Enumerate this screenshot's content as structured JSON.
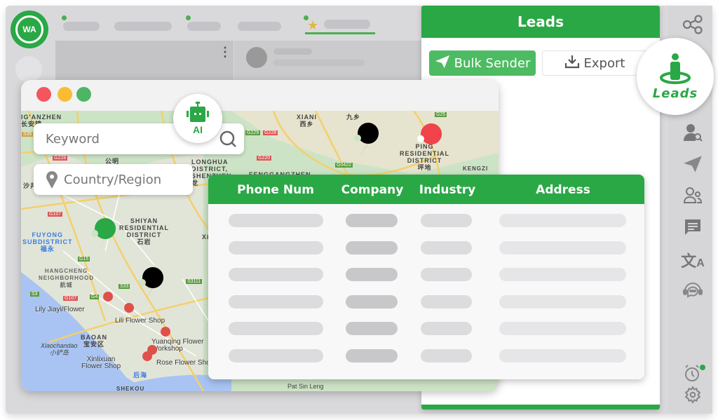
{
  "app": {
    "logo_text": "WA",
    "tabs": [
      {
        "active": false,
        "dot": true
      },
      {
        "active": false,
        "dot": false
      },
      {
        "active": false,
        "dot": true
      },
      {
        "active": false,
        "dot": false
      },
      {
        "active": true,
        "dot": true,
        "starred": true
      }
    ]
  },
  "leads_panel": {
    "title": "Leads",
    "bulk_sender_label": "Bulk Sender",
    "export_label": "Export"
  },
  "leads_badge": {
    "label": "Leads"
  },
  "right_sidebar": {
    "icons": [
      "share-icon",
      "contact-search-icon",
      "send-icon",
      "contacts-icon",
      "chat-icon",
      "translate-icon",
      "support-icon",
      "alarm-icon",
      "settings-icon"
    ]
  },
  "map_window": {
    "ai_label": "AI",
    "keyword_placeholder": "Keyword",
    "country_placeholder": "Country/Region",
    "labels": [
      "IG'ANZHEN",
      "长安镇",
      "XIANI",
      "西乡",
      "九乡",
      "PING",
      "RESIDENTIAL",
      "DISTRICT",
      "坪地",
      "LONGHUA",
      "DISTRICT,",
      "SHENZHEN",
      "龙",
      "FENGGANGZHEN",
      "公明",
      "SHIYAN",
      "RESIDENTIAL",
      "DISTRICT",
      "石岩",
      "FUYONG",
      "SUBDISTRICT",
      "福永",
      "HANGCHENG",
      "NEIGHBORHOOD",
      "航城",
      "BAOAN",
      "宝安区",
      "Xiaochandao",
      "小铲岛",
      "后海",
      "SHEKOU",
      "KENGZI",
      "Pat Sin Leng",
      "Xi",
      "沙井"
    ],
    "shops": [
      "Lily Jiayi/Flower",
      "Lili Flower Shop",
      "Yuanqing Flower",
      "Workshop",
      "Xinlixuan",
      "Flower Shop",
      "Rose Flower Shop"
    ],
    "roads": [
      "G107",
      "G15",
      "G4",
      "S33",
      "S3111",
      "S3",
      "G228",
      "G220",
      "G0422",
      "G25",
      "G229",
      "S35"
    ]
  },
  "table": {
    "columns": [
      "Phone Num",
      "Company",
      "Industry",
      "Address"
    ],
    "row_count": 6
  },
  "colors": {
    "accent": "#2aa845",
    "pin_red": "#f0434a",
    "pin_green": "#2aa845",
    "pin_black": "#000000"
  }
}
